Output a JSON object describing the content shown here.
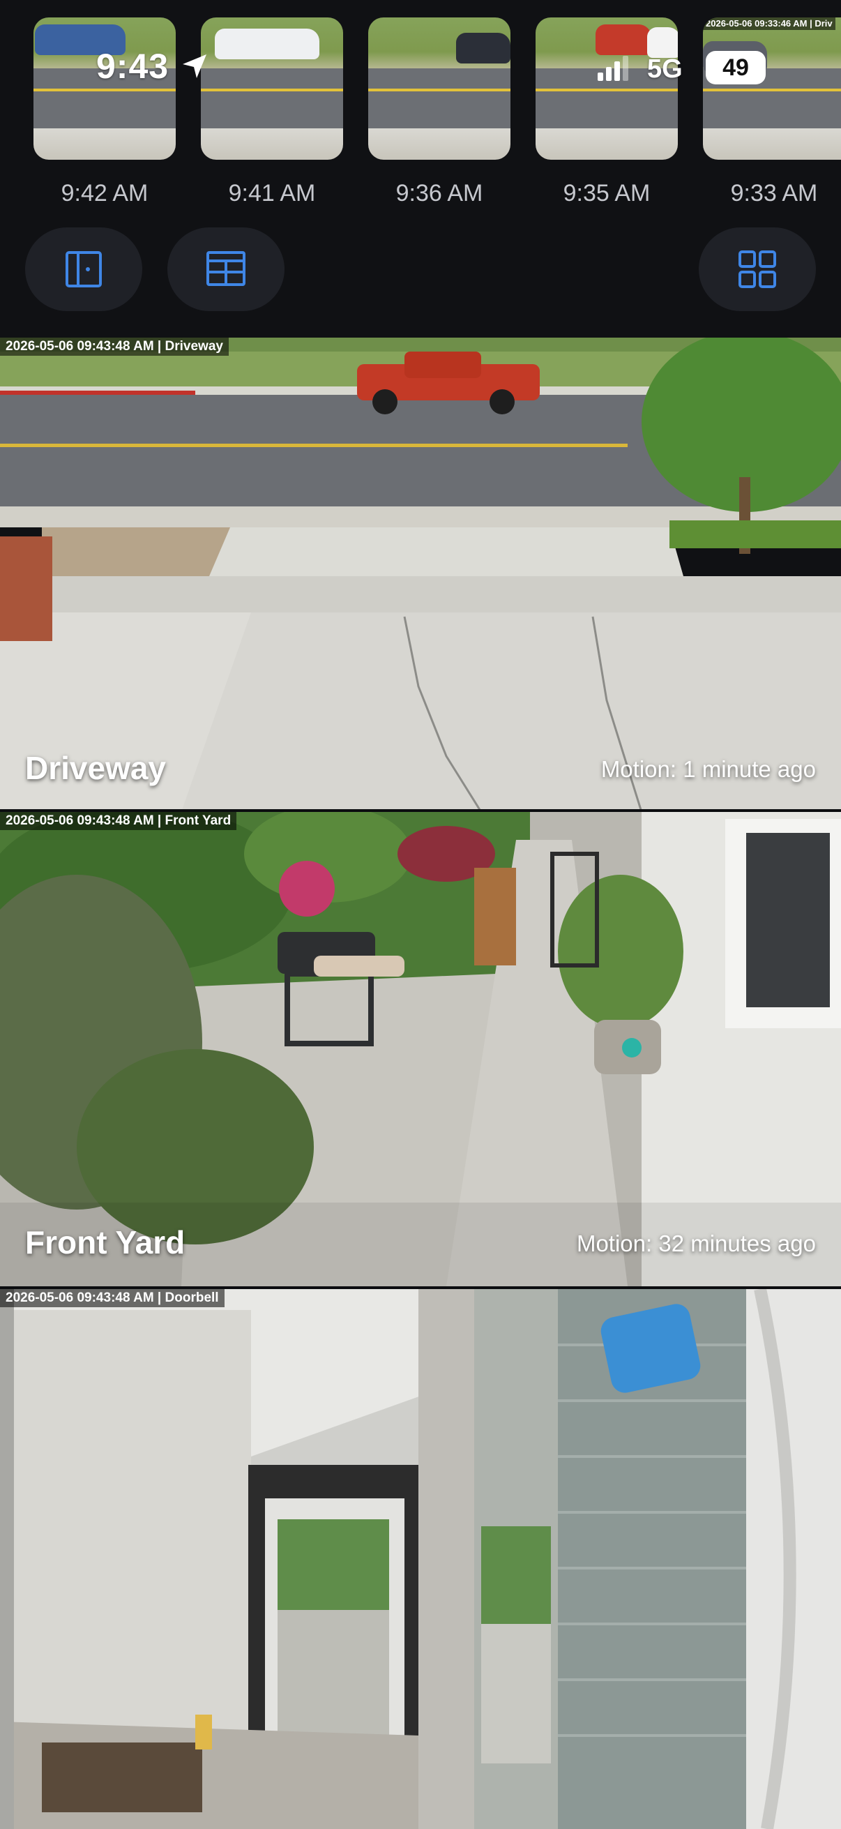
{
  "status_bar": {
    "time": "9:43",
    "network": "5G",
    "battery": "49"
  },
  "thumbnails": [
    {
      "time": "9:42 AM"
    },
    {
      "time": "9:41 AM"
    },
    {
      "time": "9:36 AM"
    },
    {
      "time": "9:35 AM"
    },
    {
      "time": "9:33 AM"
    }
  ],
  "thumbnail_stamp": "2026-05-06 09:33:46 AM | Driv",
  "controls": {
    "left_icon": "door-view-icon",
    "middle_icon": "split-layout-icon",
    "right_icon": "grid-icon"
  },
  "cameras": [
    {
      "name": "Driveway",
      "stamp": "2026-05-06 09:43:48 AM | Driveway",
      "motion": "Motion: 1 minute ago"
    },
    {
      "name": "Front Yard",
      "stamp": "2026-05-06 09:43:48 AM | Front Yard",
      "motion": "Motion: 32 minutes ago"
    },
    {
      "name": "",
      "stamp": "2026-05-06 09:43:48 AM | Doorbell",
      "motion": ""
    }
  ],
  "colors": {
    "background": "#101114",
    "control_bg": "#1f2127",
    "icon_blue": "#3f86e6",
    "timestamp_text": "#c6c8ce"
  }
}
